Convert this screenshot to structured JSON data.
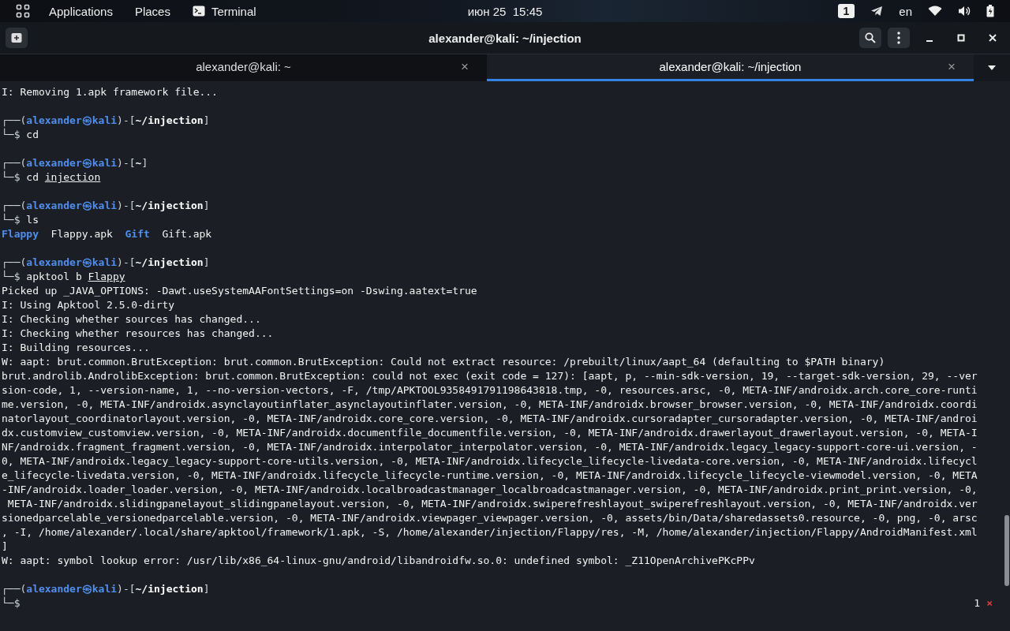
{
  "top_bar": {
    "menus": [
      {
        "label": "Applications",
        "kind": "menu"
      },
      {
        "label": "Places",
        "kind": "menu"
      },
      {
        "label": "Terminal",
        "kind": "app"
      }
    ],
    "clock": "июн 25  15:45",
    "workspace": "1",
    "language": "en"
  },
  "window": {
    "title": "alexander@kali: ~/injection"
  },
  "tabs": [
    {
      "label": "alexander@kali: ~",
      "close": "×",
      "selected": false
    },
    {
      "label": "alexander@kali: ~/injection",
      "close": "×",
      "selected": true
    }
  ],
  "terminal": {
    "lines": [
      {
        "kind": "text",
        "segments": [
          {
            "text": "I: Removing 1.apk framework file...",
            "kind": "plain"
          }
        ]
      },
      {
        "kind": "blank"
      },
      {
        "kind": "text",
        "segments": [
          {
            "text": "┌──(",
            "kind": "frame"
          },
          {
            "text": "alexander㉿kali",
            "kind": "identity"
          },
          {
            "text": ")-[",
            "kind": "frame"
          },
          {
            "text": "~/injection",
            "kind": "path"
          },
          {
            "text": "]",
            "kind": "frame"
          }
        ]
      },
      {
        "kind": "text",
        "segments": [
          {
            "text": "└─$",
            "kind": "frame"
          },
          {
            "text": " cd",
            "kind": "plain"
          }
        ]
      },
      {
        "kind": "blank"
      },
      {
        "kind": "text",
        "segments": [
          {
            "text": "┌──(",
            "kind": "frame"
          },
          {
            "text": "alexander㉿kali",
            "kind": "identity"
          },
          {
            "text": ")-[",
            "kind": "frame"
          },
          {
            "text": "~",
            "kind": "path"
          },
          {
            "text": "]",
            "kind": "frame"
          }
        ]
      },
      {
        "kind": "text",
        "segments": [
          {
            "text": "└─$",
            "kind": "frame"
          },
          {
            "text": " cd ",
            "kind": "plain"
          },
          {
            "text": "injection",
            "kind": "underline"
          }
        ]
      },
      {
        "kind": "blank"
      },
      {
        "kind": "text",
        "segments": [
          {
            "text": "┌──(",
            "kind": "frame"
          },
          {
            "text": "alexander㉿kali",
            "kind": "identity"
          },
          {
            "text": ")-[",
            "kind": "frame"
          },
          {
            "text": "~/injection",
            "kind": "path"
          },
          {
            "text": "]",
            "kind": "frame"
          }
        ]
      },
      {
        "kind": "text",
        "segments": [
          {
            "text": "└─$",
            "kind": "frame"
          },
          {
            "text": " ls",
            "kind": "plain"
          }
        ]
      },
      {
        "kind": "text",
        "segments": [
          {
            "text": "Flappy",
            "kind": "dir"
          },
          {
            "text": "  Flappy.apk  ",
            "kind": "plain"
          },
          {
            "text": "Gift",
            "kind": "dir"
          },
          {
            "text": "  Gift.apk",
            "kind": "plain"
          }
        ]
      },
      {
        "kind": "blank"
      },
      {
        "kind": "text",
        "segments": [
          {
            "text": "┌──(",
            "kind": "frame"
          },
          {
            "text": "alexander㉿kali",
            "kind": "identity"
          },
          {
            "text": ")-[",
            "kind": "frame"
          },
          {
            "text": "~/injection",
            "kind": "path"
          },
          {
            "text": "]",
            "kind": "frame"
          }
        ]
      },
      {
        "kind": "text",
        "segments": [
          {
            "text": "└─$",
            "kind": "frame"
          },
          {
            "text": " apktool b ",
            "kind": "plain"
          },
          {
            "text": "Flappy",
            "kind": "underline"
          }
        ]
      },
      {
        "kind": "text",
        "segments": [
          {
            "text": "Picked up _JAVA_OPTIONS: -Dawt.useSystemAAFontSettings=on -Dswing.aatext=true",
            "kind": "plain"
          }
        ]
      },
      {
        "kind": "text",
        "segments": [
          {
            "text": "I: Using Apktool 2.5.0-dirty",
            "kind": "plain"
          }
        ]
      },
      {
        "kind": "text",
        "segments": [
          {
            "text": "I: Checking whether sources has changed...",
            "kind": "plain"
          }
        ]
      },
      {
        "kind": "text",
        "segments": [
          {
            "text": "I: Checking whether resources has changed...",
            "kind": "plain"
          }
        ]
      },
      {
        "kind": "text",
        "segments": [
          {
            "text": "I: Building resources...",
            "kind": "plain"
          }
        ]
      },
      {
        "kind": "text",
        "segments": [
          {
            "text": "W: aapt: brut.common.BrutException: brut.common.BrutException: Could not extract resource: /prebuilt/linux/aapt_64 (defaulting to $PATH binary)",
            "kind": "plain"
          }
        ]
      },
      {
        "kind": "text",
        "segments": [
          {
            "text": "brut.androlib.AndrolibException: brut.common.BrutException: could not exec (exit code = 127): [aapt, p, --min-sdk-version, 19, --target-sdk-version, 29, --ver",
            "kind": "plain"
          }
        ]
      },
      {
        "kind": "text",
        "segments": [
          {
            "text": "sion-code, 1, --version-name, 1, --no-version-vectors, -F, /tmp/APKTOOL9358491791198643818.tmp, -0, resources.arsc, -0, META-INF/androidx.arch.core_core-runti",
            "kind": "plain"
          }
        ]
      },
      {
        "kind": "text",
        "segments": [
          {
            "text": "me.version, -0, META-INF/androidx.asynclayoutinflater_asynclayoutinflater.version, -0, META-INF/androidx.browser_browser.version, -0, META-INF/androidx.coordi",
            "kind": "plain"
          }
        ]
      },
      {
        "kind": "text",
        "segments": [
          {
            "text": "natorlayout_coordinatorlayout.version, -0, META-INF/androidx.core_core.version, -0, META-INF/androidx.cursoradapter_cursoradapter.version, -0, META-INF/androi",
            "kind": "plain"
          }
        ]
      },
      {
        "kind": "text",
        "segments": [
          {
            "text": "dx.customview_customview.version, -0, META-INF/androidx.documentfile_documentfile.version, -0, META-INF/androidx.drawerlayout_drawerlayout.version, -0, META-I",
            "kind": "plain"
          }
        ]
      },
      {
        "kind": "text",
        "segments": [
          {
            "text": "NF/androidx.fragment_fragment.version, -0, META-INF/androidx.interpolator_interpolator.version, -0, META-INF/androidx.legacy_legacy-support-core-ui.version, -",
            "kind": "plain"
          }
        ]
      },
      {
        "kind": "text",
        "segments": [
          {
            "text": "0, META-INF/androidx.legacy_legacy-support-core-utils.version, -0, META-INF/androidx.lifecycle_lifecycle-livedata-core.version, -0, META-INF/androidx.lifecycl",
            "kind": "plain"
          }
        ]
      },
      {
        "kind": "text",
        "segments": [
          {
            "text": "e_lifecycle-livedata.version, -0, META-INF/androidx.lifecycle_lifecycle-runtime.version, -0, META-INF/androidx.lifecycle_lifecycle-viewmodel.version, -0, META",
            "kind": "plain"
          }
        ]
      },
      {
        "kind": "text",
        "segments": [
          {
            "text": "-INF/androidx.loader_loader.version, -0, META-INF/androidx.localbroadcastmanager_localbroadcastmanager.version, -0, META-INF/androidx.print_print.version, -0,",
            "kind": "plain"
          }
        ]
      },
      {
        "kind": "text",
        "segments": [
          {
            "text": " META-INF/androidx.slidingpanelayout_slidingpanelayout.version, -0, META-INF/androidx.swiperefreshlayout_swiperefreshlayout.version, -0, META-INF/androidx.ver",
            "kind": "plain"
          }
        ]
      },
      {
        "kind": "text",
        "segments": [
          {
            "text": "sionedparcelable_versionedparcelable.version, -0, META-INF/androidx.viewpager_viewpager.version, -0, assets/bin/Data/sharedassets0.resource, -0, png, -0, arsc",
            "kind": "plain"
          }
        ]
      },
      {
        "kind": "text",
        "segments": [
          {
            "text": ", -I, /home/alexander/.local/share/apktool/framework/1.apk, -S, /home/alexander/injection/Flappy/res, -M, /home/alexander/injection/Flappy/AndroidManifest.xml",
            "kind": "plain"
          }
        ]
      },
      {
        "kind": "text",
        "segments": [
          {
            "text": "]",
            "kind": "plain"
          }
        ]
      },
      {
        "kind": "text",
        "segments": [
          {
            "text": "W: aapt: symbol lookup error: /usr/lib/x86_64-linux-gnu/android/libandroidfw.so.0: undefined symbol: _Z11OpenArchivePKcPPv",
            "kind": "plain"
          }
        ]
      },
      {
        "kind": "blank"
      },
      {
        "kind": "text",
        "segments": [
          {
            "text": "┌──(",
            "kind": "frame"
          },
          {
            "text": "alexander㉿kali",
            "kind": "identity"
          },
          {
            "text": ")-[",
            "kind": "frame"
          },
          {
            "text": "~/injection",
            "kind": "path"
          },
          {
            "text": "]",
            "kind": "frame"
          }
        ]
      },
      {
        "kind": "text",
        "segments": [
          {
            "text": "└─$",
            "kind": "frame"
          }
        ]
      }
    ],
    "status": {
      "count": "1",
      "close": "×"
    }
  }
}
